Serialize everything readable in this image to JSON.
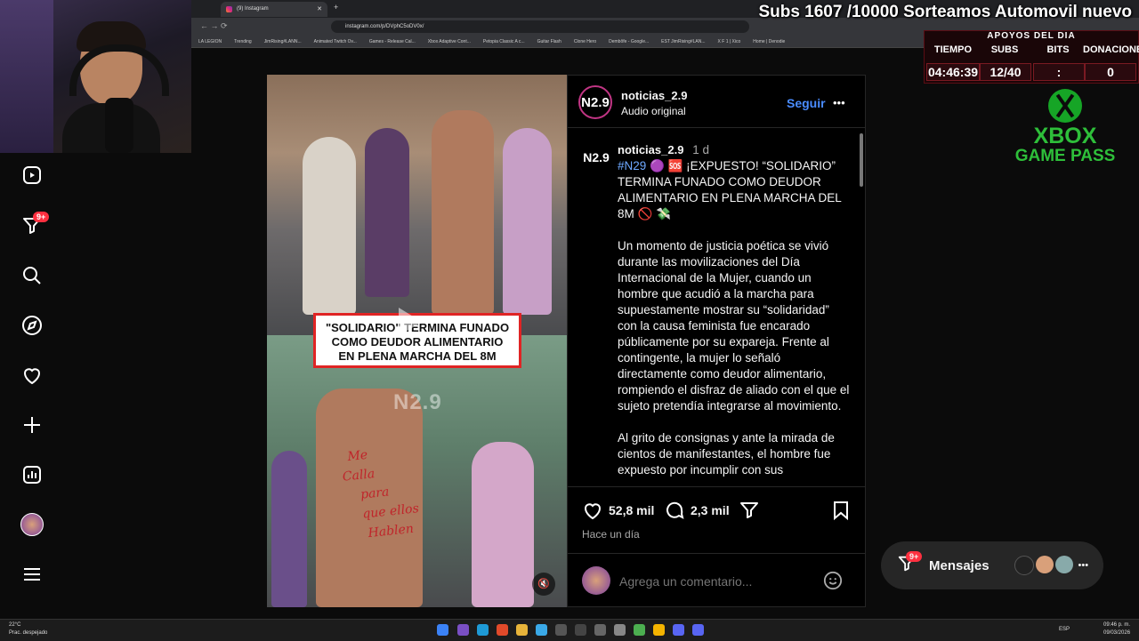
{
  "stream": {
    "title": "Subs 1607 /10000 Sorteamos Automovil nuevo",
    "apoyos_header": "APOYOS DEL DIA",
    "columns": [
      "TIEMPO",
      "SUBS",
      "BITS",
      "DONACIONES"
    ],
    "values": [
      "04:46:39",
      "12/40",
      ":",
      "0"
    ],
    "xbox_line1": "XBOX",
    "xbox_line2": "GAME PASS"
  },
  "browser": {
    "tab_title": "(9) Instagram",
    "url": "instagram.com/p/DVphC5oDV0x/",
    "bookmarks": [
      "LA LEGION",
      "Trending",
      "JimRising#LANN...",
      "Animated Twitch Ov...",
      "Games - Release Cal...",
      "Xbox Adaptive Cont...",
      "Petopia Classic A c...",
      "Guitar Flash",
      "Clone Hero",
      "Dembôfe - Google...",
      "EST JimRising#LAN...",
      "X F 1 | Xico",
      "Home | Denodie"
    ]
  },
  "nav": {
    "notifications_badge": "9+"
  },
  "post": {
    "username": "noticias_2.9",
    "audio": "Audio original",
    "follow_label": "Seguir",
    "more_label": "•••",
    "avatar_text": "N2.9",
    "caption_username": "noticias_2.9",
    "caption_time": "1 d",
    "hashtag": "#N29",
    "caption_headline": "🟣 🆘 ¡EXPUESTO! “SOLIDARIO” TERMINA FUNADO COMO DEUDOR ALIMENTARIO EN PLENA MARCHA DEL 8M 🚫 💸",
    "caption_p1": "Un momento de justicia poética se vivió durante las movilizaciones del Día Internacional de la Mujer, cuando un hombre que acudió a la marcha para supuestamente mostrar su “solidaridad” con la causa feminista fue encarado públicamente por su expareja. Frente al contingente, la mujer lo señaló directamente como deudor alimentario, rompiendo el disfraz de aliado con el que el sujeto pretendía integrarse al movimiento.",
    "caption_p2": "Al grito de consignas y ante la mirada de cientos de manifestantes, el hombre fue expuesto por incumplir con sus",
    "likes": "52,8 mil",
    "comments": "2,3 mil",
    "posted": "Hace un día",
    "comment_placeholder": "Agrega un comentario...",
    "media_caption": [
      "\"SOLIDARIO\" TERMINA FUNADO",
      "COMO DEUDOR ALIMENTARIO",
      "EN PLENA MARCHA DEL 8M"
    ],
    "watermark": "N2.9",
    "back_writing": [
      "Me",
      "Calla",
      "para",
      "que ellos",
      "Hablen"
    ]
  },
  "messages": {
    "label": "Mensajes",
    "badge": "9+"
  },
  "taskbar": {
    "weather_temp": "22°C",
    "weather_desc": "Prac. despejado",
    "lang": "ESP",
    "time": "09:46 p. m.",
    "date": "09/03/2026"
  },
  "colors": {
    "instagram_blue": "#4a8cff",
    "badge_red": "#ff3040",
    "xbox_green": "#2ebf3a",
    "caption_border": "#e02424"
  }
}
